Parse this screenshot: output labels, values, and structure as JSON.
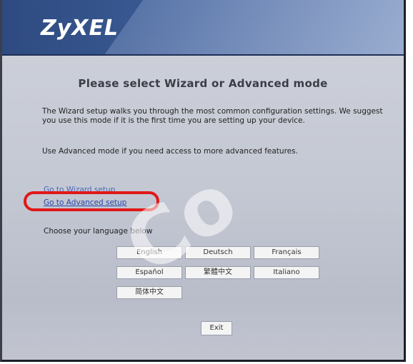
{
  "header": {
    "logo": "ZyXEL"
  },
  "main": {
    "title": "Please select Wizard or Advanced mode",
    "wizard_description": "The Wizard setup walks you through the most common configuration settings. We suggest you use this mode if it is the first time you are setting up your device.",
    "advanced_description": "Use Advanced mode if you need access to more advanced features.",
    "wizard_link": "Go to Wizard setup",
    "advanced_link": "Go to Advanced setup",
    "language_prompt": "Choose your language below"
  },
  "languages": [
    "English",
    "Deutsch",
    "Français",
    "Español",
    "繁體中文",
    "Italiano",
    "简体中文"
  ],
  "exit_label": "Exit",
  "colors": {
    "header_bg": "#3c5c96",
    "highlight": "#e01818",
    "link": "#2646a8"
  }
}
